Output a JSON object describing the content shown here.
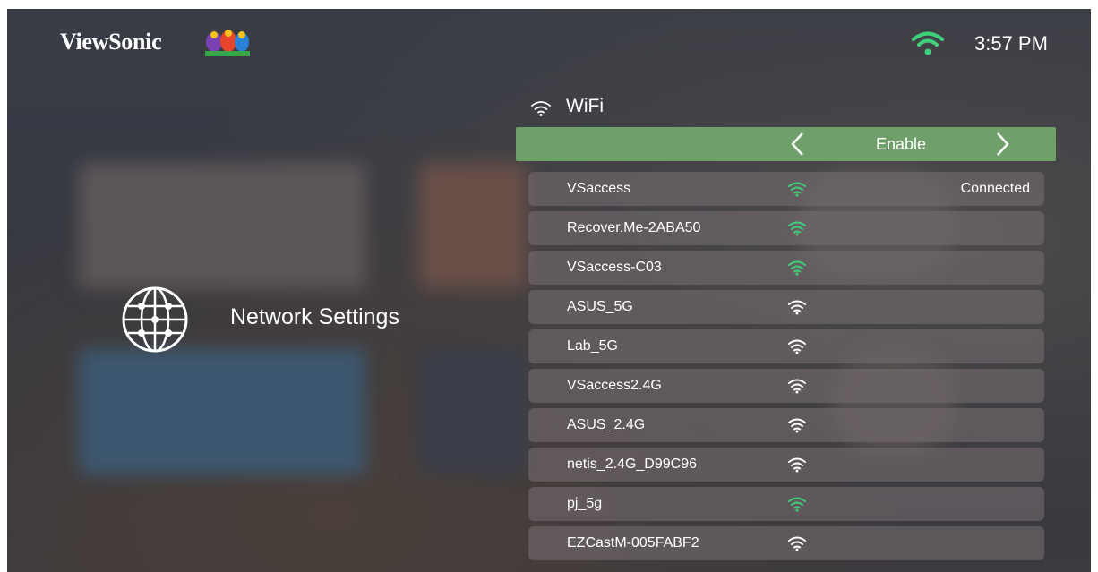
{
  "header": {
    "brand": "ViewSonic",
    "time": "3:57 PM",
    "status_icon": "wifi-icon",
    "accent_color": "#3fcf7a"
  },
  "sidebar": {
    "title": "Network Settings",
    "icon": "globe-network-icon"
  },
  "wifi_panel": {
    "title": "WiFi",
    "enable_value": "Enable",
    "highlight_color": "#6fa06a"
  },
  "networks": [
    {
      "name": "VSaccess",
      "status": "Connected",
      "signal_color": "#3fcf7a"
    },
    {
      "name": "Recover.Me-2ABA50",
      "status": "",
      "signal_color": "#3fcf7a"
    },
    {
      "name": "VSaccess-C03",
      "status": "",
      "signal_color": "#3fcf7a"
    },
    {
      "name": "ASUS_5G",
      "status": "",
      "signal_color": "#ffffff"
    },
    {
      "name": "Lab_5G",
      "status": "",
      "signal_color": "#ffffff"
    },
    {
      "name": "VSaccess2.4G",
      "status": "",
      "signal_color": "#ffffff"
    },
    {
      "name": "ASUS_2.4G",
      "status": "",
      "signal_color": "#ffffff"
    },
    {
      "name": "netis_2.4G_D99C96",
      "status": "",
      "signal_color": "#ffffff"
    },
    {
      "name": "pj_5g",
      "status": "",
      "signal_color": "#3fcf7a"
    },
    {
      "name": "EZCastM-005FABF2",
      "status": "",
      "signal_color": "#ffffff"
    }
  ]
}
